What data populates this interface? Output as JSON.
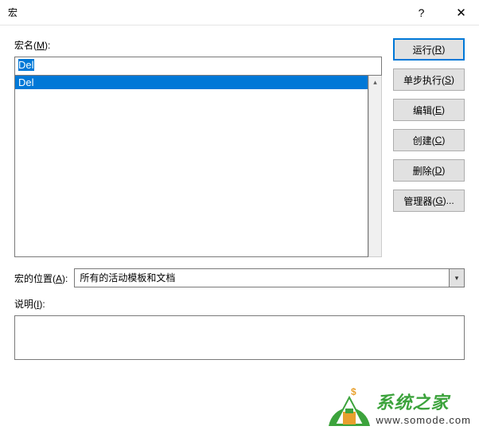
{
  "titlebar": {
    "title": "宏",
    "help": "?",
    "close": "✕"
  },
  "labels": {
    "macroName": "宏名(M):",
    "macroLocation": "宏的位置(A):",
    "description": "说明(I):"
  },
  "macroInput": "Del",
  "macroList": [
    "Del"
  ],
  "buttons": {
    "run": "运行(R)",
    "step": "单步执行(S)",
    "edit": "编辑(E)",
    "create": "创建(C)",
    "delete": "删除(D)",
    "manager": "管理器(G)..."
  },
  "location": {
    "selected": "所有的活动模板和文档"
  },
  "watermark": {
    "title": "系统之家",
    "url": "www.somode.com"
  }
}
